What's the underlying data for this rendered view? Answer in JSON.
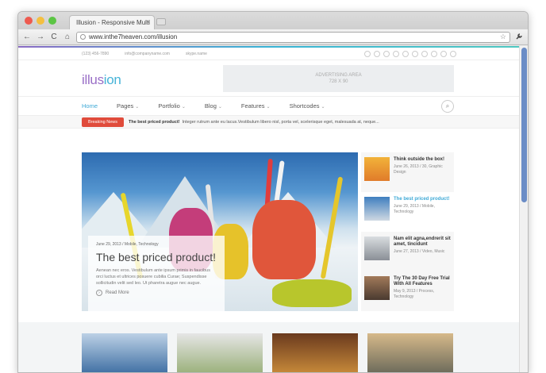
{
  "browser": {
    "tab_title": "Illusion - Responsive Multi",
    "tab_close": "x",
    "url": "www.inthe7heaven.com/illusion",
    "buttons": {
      "back": "←",
      "forward": "→",
      "reload": "C",
      "home": "⌂",
      "star": "☆",
      "wrench": "🔧"
    },
    "traffic_colors": [
      "#ee5a4f",
      "#f4bf40",
      "#5cc544"
    ]
  },
  "site": {
    "topbar": {
      "phone": "(123) 456-7890",
      "email": "info@companyname.com",
      "skype": "skype.name"
    },
    "logo": {
      "part1": "illus",
      "part2": "ion"
    },
    "ad": {
      "line1": "ADVERTISING AREA",
      "line2": "728 X 90"
    },
    "menu": [
      {
        "label": "Home",
        "active": true
      },
      {
        "label": "Pages"
      },
      {
        "label": "Portfolio"
      },
      {
        "label": "Blog"
      },
      {
        "label": "Features"
      },
      {
        "label": "Shortcodes"
      }
    ],
    "breaking": {
      "badge": "Breaking News",
      "headline": "The best priced product!",
      "text": "Integer rutrum ante eu lacus.Vestibulum libero nisl, porta vel, scelerisque eget, malesuada at, neque..."
    },
    "feature": {
      "meta": "June 29, 2013  /  Mobile, Technology",
      "title": "The best priced product!",
      "excerpt": "Aenean nec eros. Vestibulum ante ipsum primis in faucibus orci luctus et ultrices posuere cubilia Curae; Suspendisse sollicitudin velit sed leo. Ut pharetra augue nec augue.",
      "more": "Read More"
    },
    "side_posts": [
      {
        "title": "Think outside the box!",
        "meta": "June 26, 2013  /  30, Graphic Design",
        "active": false
      },
      {
        "title": "The best priced product!",
        "meta": "June 29, 2013  /  Mobile, Technology",
        "active": true
      },
      {
        "title": "Nam elit agna,endrerit sit amet, tincidunt",
        "meta": "June 27, 2013  /  Video, Music",
        "active": false
      },
      {
        "title": "Try The 30 Day Free Trial With All Features",
        "meta": "May 9, 2013  /  Process, Technology",
        "active": false
      }
    ],
    "colors": {
      "accent_blue": "#3ea9d6",
      "logo_purple": "#9a6fc7",
      "breaking_red": "#e04b3b"
    }
  }
}
